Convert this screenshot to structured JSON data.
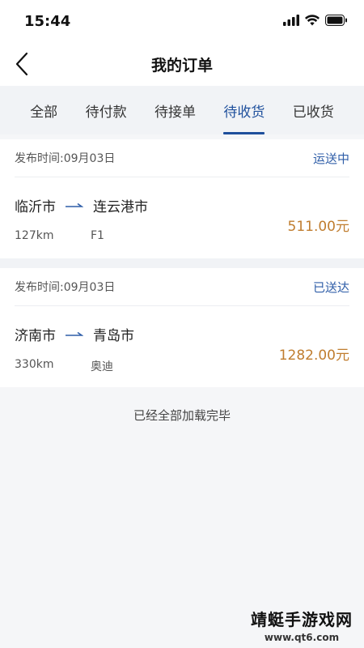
{
  "status_bar": {
    "time": "15:44"
  },
  "nav": {
    "title": "我的订单"
  },
  "tabs": [
    {
      "label": "全部"
    },
    {
      "label": "待付款"
    },
    {
      "label": "待接单"
    },
    {
      "label": "待收货"
    },
    {
      "label": "已收货"
    }
  ],
  "active_tab": "待收货",
  "orders": [
    {
      "date": "发布时间:09月03日",
      "status": "运送中",
      "from": "临沂市",
      "to": "连云港市",
      "distance": "127km",
      "vehicle": "F1",
      "price": "511.00元"
    },
    {
      "date": "发布时间:09月03日",
      "status": "已送达",
      "from": "济南市",
      "to": "青岛市",
      "distance": "330km",
      "vehicle": "奥迪",
      "price": "1282.00元"
    }
  ],
  "footer": {
    "text": "已经全部加载完毕"
  },
  "watermark": {
    "main": "靖蜓手游戏网",
    "sub": "www.qt6.com"
  },
  "colors": {
    "accent": "#1e4f9c",
    "price": "#c07d2f",
    "status": "#2f5ea8"
  }
}
